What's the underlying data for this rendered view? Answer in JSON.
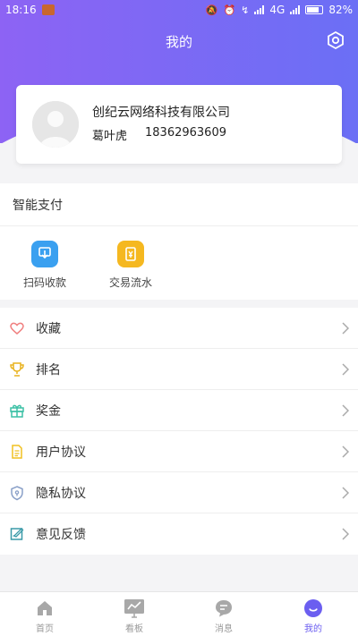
{
  "status_bar": {
    "time": "18:16",
    "network": "4G",
    "battery": "82%",
    "battery_level": 0.82
  },
  "header": {
    "title": "我的"
  },
  "profile": {
    "company": "创纪云网络科技有限公司",
    "name": "葛叶虎",
    "phone": "18362963609"
  },
  "payment": {
    "title": "智能支付",
    "items": [
      {
        "label": "扫码收款",
        "icon": "scan-receive-icon",
        "color": "#3aa0f0"
      },
      {
        "label": "交易流水",
        "icon": "transaction-record-icon",
        "color": "#f5b820"
      }
    ]
  },
  "menu": {
    "items": [
      {
        "label": "收藏",
        "icon": "heart-icon"
      },
      {
        "label": "排名",
        "icon": "trophy-icon"
      },
      {
        "label": "奖金",
        "icon": "gift-icon"
      },
      {
        "label": "用户协议",
        "icon": "document-icon"
      },
      {
        "label": "隐私协议",
        "icon": "shield-icon"
      },
      {
        "label": "意见反馈",
        "icon": "feedback-icon"
      }
    ]
  },
  "tabbar": {
    "items": [
      {
        "label": "首页",
        "icon": "home-icon"
      },
      {
        "label": "看板",
        "icon": "dashboard-icon"
      },
      {
        "label": "消息",
        "icon": "message-icon"
      },
      {
        "label": "我的",
        "icon": "profile-icon",
        "active": true
      }
    ]
  },
  "colors": {
    "accent": "#6b5ef0",
    "header_start": "#8d63f4",
    "header_end": "#6b6ff5"
  }
}
